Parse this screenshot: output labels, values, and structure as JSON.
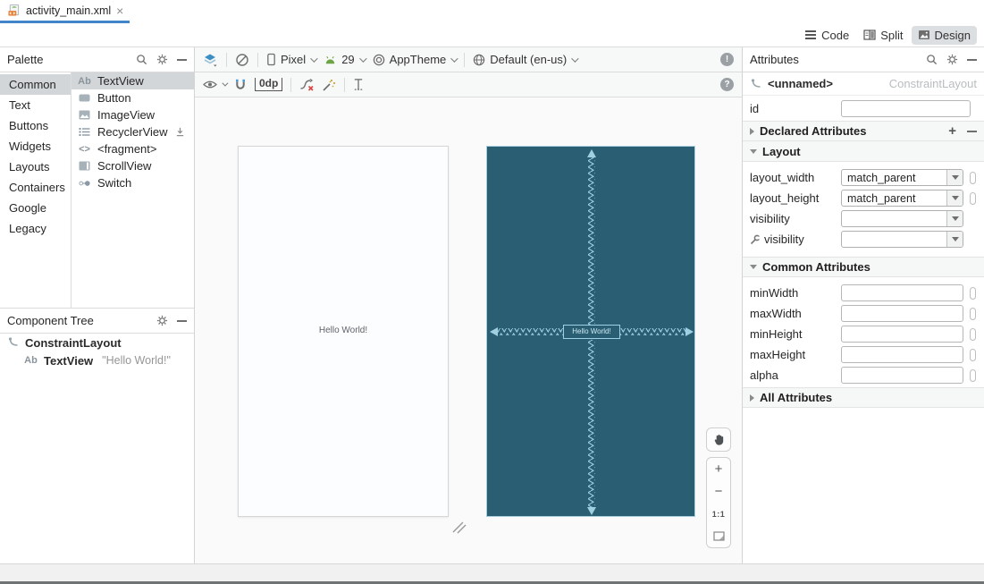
{
  "tab": {
    "title": "activity_main.xml",
    "close": "×"
  },
  "view_modes": {
    "code": "Code",
    "split": "Split",
    "design": "Design"
  },
  "icons": {
    "warning_glyph": "!",
    "help_glyph": "?",
    "plus_glyph": "+",
    "textview_glyph": "Ab",
    "fragment_glyph": "<>"
  },
  "palette": {
    "title": "Palette",
    "categories": [
      {
        "label": "Common"
      },
      {
        "label": "Text"
      },
      {
        "label": "Buttons"
      },
      {
        "label": "Widgets"
      },
      {
        "label": "Layouts"
      },
      {
        "label": "Containers"
      },
      {
        "label": "Google"
      },
      {
        "label": "Legacy"
      }
    ],
    "components": [
      {
        "label": "TextView",
        "icon": "textview-ab-icon"
      },
      {
        "label": "Button",
        "icon": "button-icon"
      },
      {
        "label": "ImageView",
        "icon": "imageview-icon"
      },
      {
        "label": "RecyclerView",
        "icon": "recyclerview-icon"
      },
      {
        "label": "<fragment>",
        "icon": "fragment-icon"
      },
      {
        "label": "ScrollView",
        "icon": "scrollview-icon"
      },
      {
        "label": "Switch",
        "icon": "switch-icon"
      }
    ]
  },
  "component_tree": {
    "title": "Component Tree",
    "items": [
      {
        "label": "ConstraintLayout",
        "detail": ""
      },
      {
        "label": "TextView",
        "detail": "\"Hello World!\""
      }
    ]
  },
  "toolbar": {
    "device": "Pixel",
    "api_level": "29",
    "theme": "AppTheme",
    "locale": "Default (en-us)",
    "default_margin": "0dp"
  },
  "canvas": {
    "design_label": "Hello World!",
    "blueprint_label": "Hello World!"
  },
  "zoom_controls": {
    "zoom_in": "+",
    "zoom_out": "−",
    "ratio": "1:1"
  },
  "attributes": {
    "title": "Attributes",
    "component_name": "<unnamed>",
    "component_type": "ConstraintLayout",
    "id_label": "id",
    "declared_section": "Declared Attributes",
    "layout_section": "Layout",
    "layout_rows": [
      {
        "label": "layout_width",
        "value": "match_parent"
      },
      {
        "label": "layout_height",
        "value": "match_parent"
      },
      {
        "label": "visibility",
        "value": ""
      },
      {
        "label": "visibility",
        "value": "",
        "tools": true
      }
    ],
    "common_section": "Common Attributes",
    "common_rows": [
      {
        "label": "minWidth"
      },
      {
        "label": "maxWidth"
      },
      {
        "label": "minHeight"
      },
      {
        "label": "maxHeight"
      },
      {
        "label": "alpha"
      }
    ],
    "all_section": "All Attributes"
  },
  "colors": {
    "accent_blue": "#4285c8",
    "blueprint_bg": "#2a5f73",
    "blueprint_line": "#9fd0e2",
    "android_green": "#6da544",
    "selection_gray": "#d2d6d9"
  }
}
